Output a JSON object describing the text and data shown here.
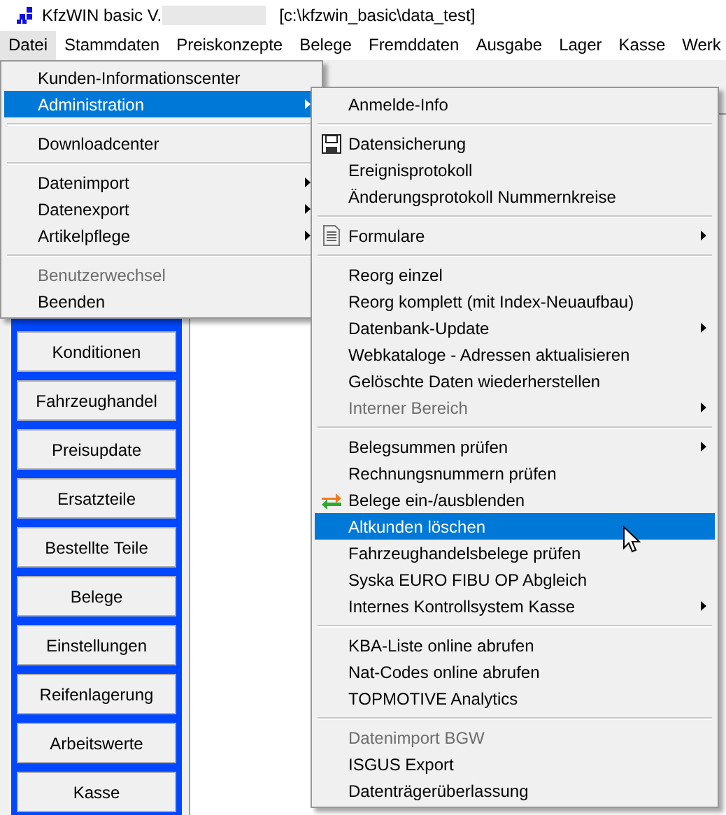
{
  "window": {
    "title": "KfzWIN basic V.",
    "path": "[c:\\kfzwin_basic\\data_test]"
  },
  "menubar": [
    {
      "label": "Datei",
      "selected": true
    },
    {
      "label": "Stammdaten",
      "selected": false
    },
    {
      "label": "Preiskonzepte",
      "selected": false
    },
    {
      "label": "Belege",
      "selected": false
    },
    {
      "label": "Fremddaten",
      "selected": false
    },
    {
      "label": "Ausgabe",
      "selected": false
    },
    {
      "label": "Lager",
      "selected": false
    },
    {
      "label": "Kasse",
      "selected": false
    },
    {
      "label": "Werk",
      "selected": false
    }
  ],
  "sidebar": {
    "buttons": [
      "Konditionen",
      "Fahrzeughandel",
      "Preisupdate",
      "Ersatzteile",
      "Bestellte Teile",
      "Belege",
      "Einstellungen",
      "Reifenlagerung",
      "Arbeitswerte",
      "Kasse"
    ]
  },
  "file_menu": [
    {
      "kind": "item",
      "label": "Kunden-Informationscenter",
      "submenu": false,
      "disabled": false,
      "selected": false
    },
    {
      "kind": "item",
      "label": "Administration",
      "submenu": true,
      "disabled": false,
      "selected": true
    },
    {
      "kind": "separator"
    },
    {
      "kind": "item",
      "label": "Downloadcenter",
      "submenu": false,
      "disabled": false,
      "selected": false
    },
    {
      "kind": "separator"
    },
    {
      "kind": "item",
      "label": "Datenimport",
      "submenu": true,
      "disabled": false,
      "selected": false
    },
    {
      "kind": "item",
      "label": "Datenexport",
      "submenu": true,
      "disabled": false,
      "selected": false
    },
    {
      "kind": "item",
      "label": "Artikelpflege",
      "submenu": true,
      "disabled": false,
      "selected": false
    },
    {
      "kind": "separator"
    },
    {
      "kind": "item",
      "label": "Benutzerwechsel",
      "submenu": false,
      "disabled": true,
      "selected": false
    },
    {
      "kind": "item",
      "label": "Beenden",
      "submenu": false,
      "disabled": false,
      "selected": false
    }
  ],
  "admin_menu": [
    {
      "kind": "item",
      "label": "Anmelde-Info",
      "submenu": false,
      "disabled": false,
      "selected": false
    },
    {
      "kind": "separator"
    },
    {
      "kind": "item",
      "label": "Datensicherung",
      "submenu": false,
      "disabled": false,
      "selected": false
    },
    {
      "kind": "item",
      "label": "Ereignisprotokoll",
      "submenu": false,
      "disabled": false,
      "selected": false
    },
    {
      "kind": "item",
      "label": "Änderungsprotokoll Nummernkreise",
      "submenu": false,
      "disabled": false,
      "selected": false
    },
    {
      "kind": "separator"
    },
    {
      "kind": "item",
      "label": "Formulare",
      "submenu": true,
      "disabled": false,
      "selected": false
    },
    {
      "kind": "separator"
    },
    {
      "kind": "item",
      "label": "Reorg einzel",
      "submenu": false,
      "disabled": false,
      "selected": false
    },
    {
      "kind": "item",
      "label": "Reorg komplett (mit Index-Neuaufbau)",
      "submenu": false,
      "disabled": false,
      "selected": false
    },
    {
      "kind": "item",
      "label": "Datenbank-Update",
      "submenu": true,
      "disabled": false,
      "selected": false
    },
    {
      "kind": "item",
      "label": "Webkataloge - Adressen aktualisieren",
      "submenu": false,
      "disabled": false,
      "selected": false
    },
    {
      "kind": "item",
      "label": "Gelöschte Daten wiederherstellen",
      "submenu": false,
      "disabled": false,
      "selected": false
    },
    {
      "kind": "item",
      "label": "Interner Bereich",
      "submenu": true,
      "disabled": true,
      "selected": false
    },
    {
      "kind": "separator"
    },
    {
      "kind": "item",
      "label": "Belegsummen prüfen",
      "submenu": true,
      "disabled": false,
      "selected": false
    },
    {
      "kind": "item",
      "label": "Rechnungsnummern prüfen",
      "submenu": false,
      "disabled": false,
      "selected": false
    },
    {
      "kind": "item",
      "label": "Belege ein-/ausblenden",
      "submenu": false,
      "disabled": false,
      "selected": false
    },
    {
      "kind": "item",
      "label": "Altkunden löschen",
      "submenu": false,
      "disabled": false,
      "selected": true
    },
    {
      "kind": "item",
      "label": "Fahrzeughandelsbelege prüfen",
      "submenu": false,
      "disabled": false,
      "selected": false
    },
    {
      "kind": "item",
      "label": "Syska EURO FIBU OP Abgleich",
      "submenu": false,
      "disabled": false,
      "selected": false
    },
    {
      "kind": "item",
      "label": "Internes Kontrollsystem Kasse",
      "submenu": true,
      "disabled": false,
      "selected": false
    },
    {
      "kind": "separator"
    },
    {
      "kind": "item",
      "label": "KBA-Liste online abrufen",
      "submenu": false,
      "disabled": false,
      "selected": false
    },
    {
      "kind": "item",
      "label": "Nat-Codes online abrufen",
      "submenu": false,
      "disabled": false,
      "selected": false
    },
    {
      "kind": "item",
      "label": "TOPMOTIVE Analytics",
      "submenu": false,
      "disabled": false,
      "selected": false
    },
    {
      "kind": "separator"
    },
    {
      "kind": "item",
      "label": "Datenimport BGW",
      "submenu": false,
      "disabled": true,
      "selected": false
    },
    {
      "kind": "item",
      "label": "ISGUS Export",
      "submenu": false,
      "disabled": false,
      "selected": false
    },
    {
      "kind": "item",
      "label": "Datenträgerüberlassung",
      "submenu": false,
      "disabled": false,
      "selected": false
    }
  ]
}
